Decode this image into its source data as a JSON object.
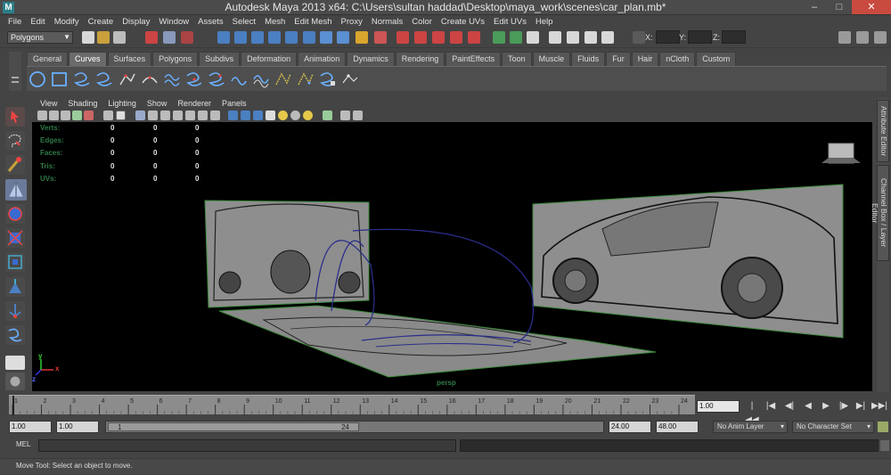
{
  "window": {
    "title": "Autodesk Maya 2013 x64: C:\\Users\\sultan haddad\\Desktop\\maya_work\\scenes\\car_plan.mb*",
    "logo": "M",
    "minimize": "–",
    "maximize": "□",
    "close": "✕"
  },
  "menus": [
    "File",
    "Edit",
    "Modify",
    "Create",
    "Display",
    "Window",
    "Assets",
    "Select",
    "Mesh",
    "Edit Mesh",
    "Proxy",
    "Normals",
    "Color",
    "Create UVs",
    "Edit UVs",
    "Help"
  ],
  "status_line": {
    "mode": "Polygons",
    "x_label": "X:",
    "y_label": "Y:",
    "z_label": "Z:"
  },
  "shelf": {
    "tabs": [
      "General",
      "Curves",
      "Surfaces",
      "Polygons",
      "Subdivs",
      "Deformation",
      "Animation",
      "Dynamics",
      "Rendering",
      "PaintEffects",
      "Toon",
      "Muscle",
      "Fluids",
      "Fur",
      "Hair",
      "nCloth",
      "Custom"
    ],
    "active_tab": "Curves"
  },
  "panel": {
    "menus": [
      "View",
      "Shading",
      "Lighting",
      "Show",
      "Renderer",
      "Panels"
    ],
    "camera_label": "persp",
    "hud": [
      {
        "label": "Verts:",
        "v1": "0",
        "v2": "0",
        "v3": "0"
      },
      {
        "label": "Edges:",
        "v1": "0",
        "v2": "0",
        "v3": "0"
      },
      {
        "label": "Faces:",
        "v1": "0",
        "v2": "0",
        "v3": "0"
      },
      {
        "label": "Tris:",
        "v1": "0",
        "v2": "0",
        "v3": "0"
      },
      {
        "label": "UVs:",
        "v1": "0",
        "v2": "0",
        "v3": "0"
      }
    ],
    "axis": {
      "x": "x",
      "y": "y",
      "z": "z"
    }
  },
  "side_tabs": {
    "attribute_editor": "Attribute Editor",
    "channel_box": "Channel Box / Layer Editor"
  },
  "timeline": {
    "ticks": [
      "1",
      "2",
      "3",
      "4",
      "5",
      "6",
      "7",
      "8",
      "9",
      "10",
      "11",
      "12",
      "13",
      "14",
      "15",
      "16",
      "17",
      "18",
      "19",
      "20",
      "21",
      "22",
      "23",
      "24"
    ],
    "current_frame": "1.00",
    "playback": {
      "go_start": "|◀◀",
      "step_back": "|◀",
      "prev_key": "◀|",
      "play_back": "◀",
      "play": "▶",
      "next_key": "|▶",
      "step_fwd": "▶|",
      "go_end": "▶▶|"
    }
  },
  "range": {
    "start_time": "1.00",
    "playback_start": "1.00",
    "slider_start": "1",
    "slider_end": "24",
    "playback_end": "24.00",
    "end_time": "48.00",
    "anim_layer": "No Anim Layer",
    "char_set": "No Character Set"
  },
  "command_line": {
    "label": "MEL"
  },
  "help_line": "Move Tool: Select an object to move.",
  "colors": {
    "accent": "#6b6b6b",
    "hud_label": "#2e7a46",
    "curve": "#2a2e8a",
    "close": "#c94b3f"
  }
}
